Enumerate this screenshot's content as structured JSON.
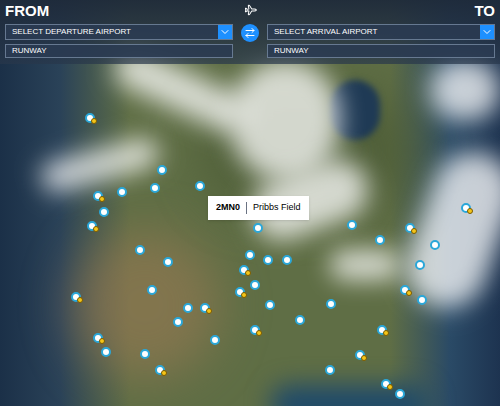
{
  "header": {
    "from_label": "FROM",
    "to_label": "TO"
  },
  "departure": {
    "airport_placeholder": "SELECT DEPARTURE AIRPORT",
    "runway_placeholder": "RUNWAY"
  },
  "arrival": {
    "airport_placeholder": "SELECT ARRIVAL AIRPORT",
    "runway_placeholder": "RUNWAY"
  },
  "map": {
    "tooltip": {
      "code": "2MN0",
      "name": "Pribbs Field"
    },
    "markers": [
      {
        "kind": "star"
      },
      {
        "kind": "star"
      },
      {
        "kind": "plain"
      },
      {
        "kind": "plain"
      },
      {
        "kind": "plain"
      },
      {
        "kind": "plain"
      },
      {
        "kind": "plain"
      },
      {
        "kind": "star"
      },
      {
        "kind": "plain"
      },
      {
        "kind": "plain"
      },
      {
        "kind": "plain"
      },
      {
        "kind": "plain"
      },
      {
        "kind": "star"
      },
      {
        "kind": "plain"
      },
      {
        "kind": "star"
      },
      {
        "kind": "star"
      },
      {
        "kind": "plain"
      },
      {
        "kind": "plain"
      },
      {
        "kind": "star"
      },
      {
        "kind": "plain"
      },
      {
        "kind": "plain"
      },
      {
        "kind": "star"
      },
      {
        "kind": "plain"
      },
      {
        "kind": "plain"
      },
      {
        "kind": "star"
      },
      {
        "kind": "plain"
      },
      {
        "kind": "plain"
      },
      {
        "kind": "plain"
      },
      {
        "kind": "star"
      },
      {
        "kind": "plain"
      },
      {
        "kind": "plain"
      },
      {
        "kind": "plain"
      },
      {
        "kind": "plain"
      },
      {
        "kind": "star"
      },
      {
        "kind": "plain"
      },
      {
        "kind": "star"
      },
      {
        "kind": "plain"
      },
      {
        "kind": "star"
      },
      {
        "kind": "plain"
      },
      {
        "kind": "star"
      },
      {
        "kind": "star"
      },
      {
        "kind": "plain"
      },
      {
        "kind": "star"
      },
      {
        "kind": "plain"
      }
    ]
  }
}
